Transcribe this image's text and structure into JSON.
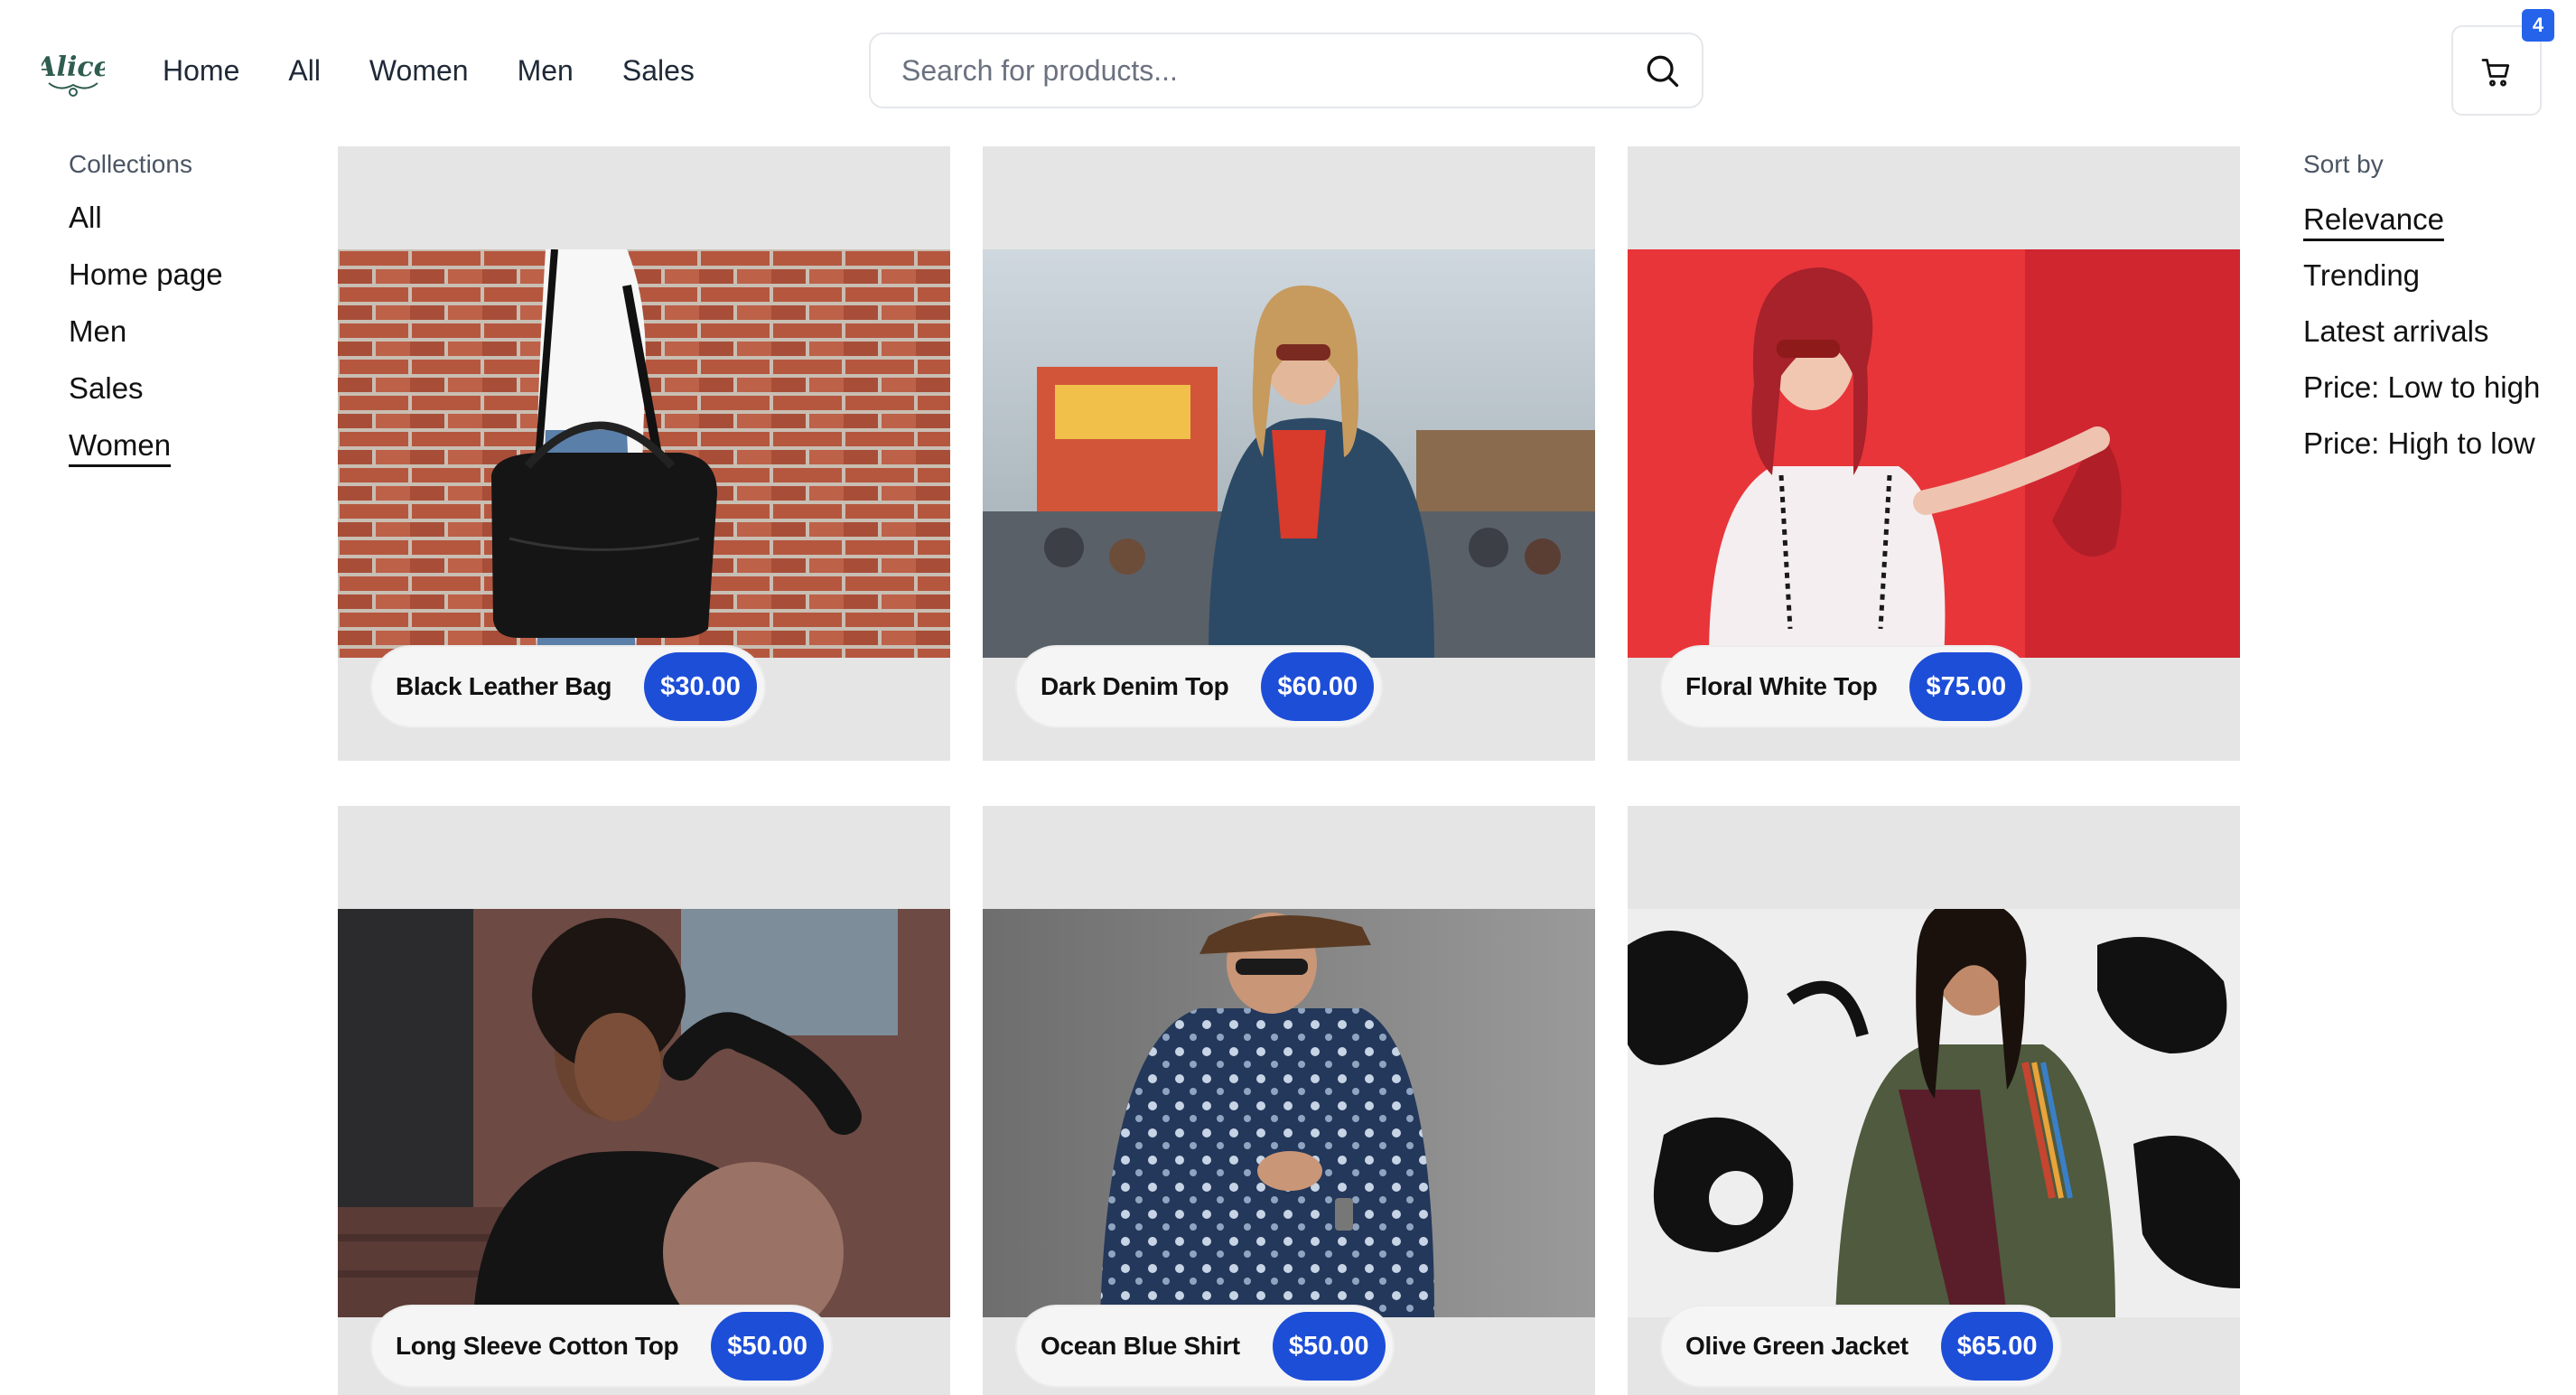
{
  "brand": {
    "logo_text": "Alice"
  },
  "nav": {
    "items": [
      "Home",
      "All",
      "Women",
      "Men",
      "Sales"
    ]
  },
  "search": {
    "placeholder": "Search for products...",
    "value": ""
  },
  "cart": {
    "count": "4",
    "icon": "cart-icon"
  },
  "collections": {
    "title": "Collections",
    "items": [
      "All",
      "Home page",
      "Men",
      "Sales",
      "Women"
    ],
    "active": "Women"
  },
  "sort": {
    "title": "Sort by",
    "items": [
      "Relevance",
      "Trending",
      "Latest arrivals",
      "Price: Low to high",
      "Price: High to low"
    ],
    "active": "Relevance"
  },
  "products": [
    {
      "name": "Black Leather Bag",
      "price": "$30.00"
    },
    {
      "name": "Dark Denim Top",
      "price": "$60.00"
    },
    {
      "name": "Floral White Top",
      "price": "$75.00"
    },
    {
      "name": "Long Sleeve Cotton Top",
      "price": "$50.00"
    },
    {
      "name": "Ocean Blue Shirt",
      "price": "$50.00"
    },
    {
      "name": "Olive Green Jacket",
      "price": "$65.00"
    }
  ],
  "colors": {
    "accent": "#1d4ed8",
    "card_bg": "#e5e5e5"
  }
}
